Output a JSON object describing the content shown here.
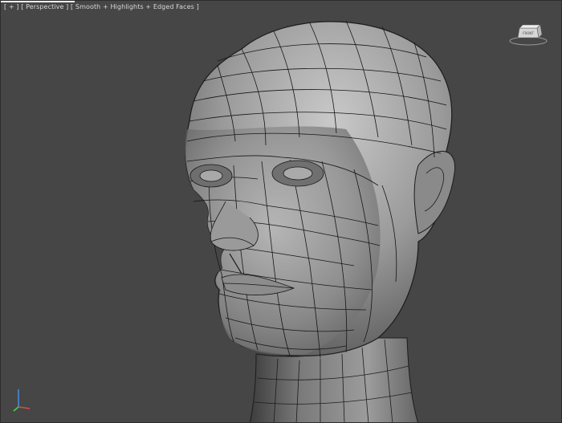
{
  "viewport": {
    "label_parts": [
      "[ + ]",
      " [ ",
      "Perspective",
      " ] [ ",
      "Smooth + Highlights + Edged Faces",
      " ]"
    ],
    "view_name": "Perspective",
    "shading_mode": "Smooth + Highlights + Edged Faces",
    "plus_menu": "[ + ]"
  },
  "viewcube": {
    "icon": "viewcube-icon"
  },
  "axis_gizmo": {
    "icon": "axis-tripod-icon"
  },
  "colors": {
    "background": "#464646",
    "wire": "#1a1a1a",
    "skin_light": "#c7c7c7",
    "skin_mid": "#8f8f8f",
    "skin_dark": "#4d4d4d"
  }
}
